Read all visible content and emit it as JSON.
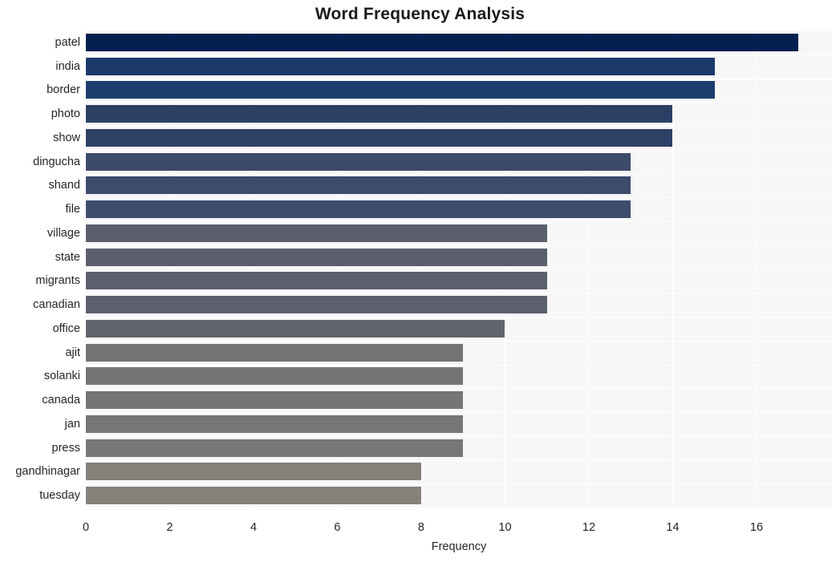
{
  "chart_data": {
    "type": "bar",
    "orientation": "horizontal",
    "title": "Word Frequency Analysis",
    "xlabel": "Frequency",
    "ylabel": "",
    "categories": [
      "patel",
      "india",
      "border",
      "photo",
      "show",
      "dingucha",
      "shand",
      "file",
      "village",
      "state",
      "migrants",
      "canadian",
      "office",
      "ajit",
      "solanki",
      "canada",
      "jan",
      "press",
      "gandhinagar",
      "tuesday"
    ],
    "values": [
      17,
      15,
      15,
      14,
      14,
      13,
      13,
      13,
      11,
      11,
      11,
      11,
      10,
      9,
      9,
      9,
      9,
      9,
      8,
      8
    ],
    "bar_colors": [
      "#042050",
      "#1b3a6b",
      "#1d3d6e",
      "#2e3f66",
      "#2f4066",
      "#3c4a6b",
      "#3d4b6c",
      "#3e4c6d",
      "#5a5e6c",
      "#5b5f6d",
      "#5c606e",
      "#5d616f",
      "#62646c",
      "#737373",
      "#747474",
      "#757575",
      "#767676",
      "#777777",
      "#83817a",
      "#84827b"
    ],
    "xlim": [
      0,
      17.8
    ],
    "x_ticks": [
      0,
      2,
      4,
      6,
      8,
      10,
      12,
      14,
      16
    ],
    "x_tick_labels": [
      "0",
      "2",
      "4",
      "6",
      "8",
      "10",
      "12",
      "14",
      "16"
    ],
    "grid": true,
    "grid_color": "#ffffff",
    "plot_background": "#f7f7f7",
    "figure_background": "#ffffff",
    "legend": null
  }
}
